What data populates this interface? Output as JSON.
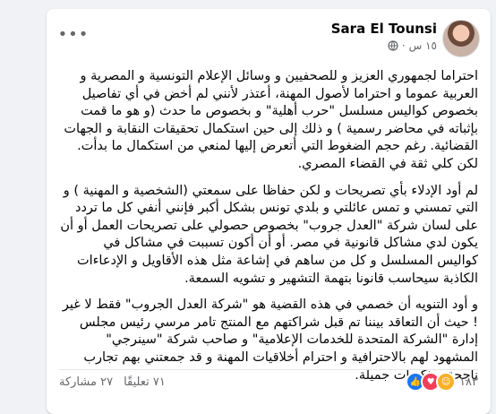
{
  "post": {
    "author": "Sara El Tounsi",
    "time": "١٥ س",
    "dot": "·",
    "paragraphs": [
      "احتراما لجمهوري العزيز و للصحفيين و وسائل الإعلام التونسية و المصرية و العربية عموما و احتراما لأصول المهنة، أعتذر لأنني لم أخض في أي تفاصيل بخصوص كواليس مسلسل \"حرب أهلية\" و بخصوص ما حدث (و هو ما قمت بإثباته في محاضر رسمية ) و ذلك إلى حين استكمال تحقيقات النقابة و الجهات القضائية. رغم حجم الضغوط التي أتعرض إليها لمنعي من استكمال ما بدأت. لكن كلي ثقة في القضاء المصري.",
      "لم أود الإدلاء بأي تصريحات و لكن حفاظا على سمعتي (الشخصية و المهنية ) و التي تمسني و تمس عائلتي و بلدي تونس بشكل أكبر فإنني أنفي كل ما تردد على لسان شركة \"العدل جروب\" بخصوص حصولي على تصريحات العمل أو أن يكون لدي مشاكل قانونية في مصر. أو أن أكون تسببت في مشاكل في كواليس المسلسل و كل من ساهم في إشاعة مثل هذه الأقاويل و الإدعاءات الكاذبة سيحاسب قانونا بتهمة التشهير و تشويه السمعة.",
      "و أود التنويه أن خصمي في هذه القضية هو \"شركة العدل الجروب\" فقط لا غير ! حيث أن التعاقد بيننا تم قبل شراكتهم مع المنتج تامر مرسي رئيس مجلس إدارة \"الشركة المتحدة للخدمات الإعلامية\" و صاحب شركة \"سينرجي\" المشهود لهم بالاحترافية و احترام أخلاقيات المهنة و قد جمعتني بهم تجارب ناجحة و ذكريات جميلة."
    ]
  },
  "footer": {
    "reaction_count": "١٨٣",
    "comments": "٧١ تعليقًا",
    "shares": "٢٧ مشاركة"
  },
  "colors": {
    "like": "#1877f2",
    "love": "#f33e58",
    "care": "#f7b125"
  }
}
